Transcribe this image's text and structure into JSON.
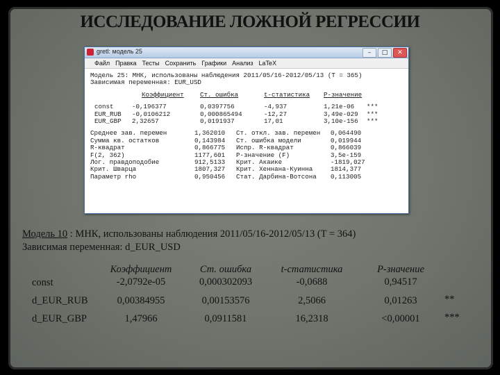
{
  "slide": {
    "title": "ИССЛЕДОВАНИЕ ЛОЖНОЙ РЕГРЕССИИ",
    "model_label": "Модель 10",
    "model_rest": ": МНК, использованы наблюдения 2011/05/16-2012/05/13 (T = 364)",
    "dependent": "Зависимая переменная: d_EUR_USD",
    "headers": [
      "Коэффициент",
      "Ст. ошибка",
      "t-статистика",
      "P-значение"
    ],
    "rows": [
      {
        "name": "const",
        "coef": "-2,0792e-05",
        "se": "0,000302093",
        "t": "-0,0688",
        "p": "0,94517",
        "stars": ""
      },
      {
        "name": "d_EUR_RUB",
        "coef": "0,00384955",
        "se": "0,00153576",
        "t": "2,5066",
        "p": "0,01263",
        "stars": "**"
      },
      {
        "name": "d_EUR_GBP",
        "coef": "1,47966",
        "se": "0,0911581",
        "t": "16,2318",
        "p": "<0,00001",
        "stars": "***"
      }
    ]
  },
  "window": {
    "title": "gretl: модель 25",
    "controls": [
      "–",
      "□",
      "✕"
    ],
    "menu": [
      "Файл",
      "Правка",
      "Тесты",
      "Сохранить",
      "Графики",
      "Анализ",
      "LaTeX"
    ],
    "model_line": "Модель 25: МНК, использованы наблюдения 2011/05/16-2012/05/13 (T = 365)",
    "dependent": "Зависимая переменная: EUR_USD",
    "headers": [
      "Коэффициент",
      "Ст. ошибка",
      "t-статистика",
      "P-значение"
    ],
    "coef_rows": [
      {
        "name": "const",
        "coef": "-0,196377",
        "se": "0,0397756",
        "t": "-4,937",
        "p": "1,21e-06",
        "stars": "***"
      },
      {
        "name": "EUR_RUB",
        "coef": "-0,0106212",
        "se": "0,000865494",
        "t": "-12,27",
        "p": "3,49e-029",
        "stars": "***"
      },
      {
        "name": "EUR_GBP",
        "coef": "2,32657",
        "se": "0,0191937",
        "t": "17,01",
        "p": "3,10e-156",
        "stars": "***"
      }
    ],
    "stats_rows": [
      {
        "l1": "Среднее зав. перемен",
        "v1": "1,362010",
        "l2": "Ст. откл. зав. перемен",
        "v2": "0,064490"
      },
      {
        "l1": "Сумма кв. остатков",
        "v1": "0,143984",
        "l2": "Ст. ошибка модели",
        "v2": "0,019944"
      },
      {
        "l1": "R-квадрат",
        "v1": "0,866775",
        "l2": "Испр. R-квадрат",
        "v2": "0,866039"
      },
      {
        "l1": "F(2, 362)",
        "v1": "1177,601",
        "l2": "P-значение (F)",
        "v2": "3,5e-159"
      },
      {
        "l1": "Лог. правдоподобие",
        "v1": "912,5133",
        "l2": "Крит. Акаике",
        "v2": "-1819,027"
      },
      {
        "l1": "Крит. Шварца",
        "v1": "1807,327",
        "l2": "Крит. Хеннана-Куинна",
        "v2": "1814,377"
      },
      {
        "l1": "Параметр rho",
        "v1": "0,950456",
        "l2": "Стат. Дарбина-Вотсона",
        "v2": "0,113005"
      }
    ]
  }
}
